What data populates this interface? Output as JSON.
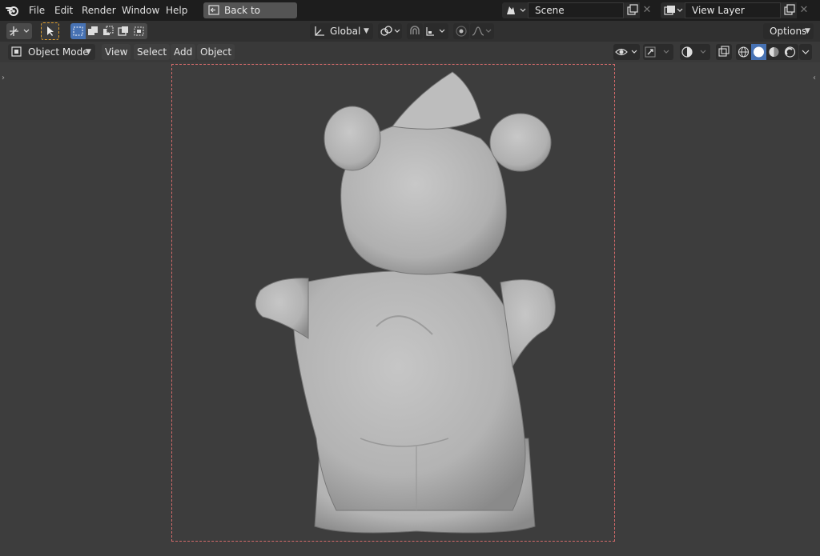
{
  "topbar": {
    "menus": [
      "File",
      "Edit",
      "Render",
      "Window",
      "Help"
    ],
    "back_button": "Back to Previous",
    "scene": {
      "value": "Scene"
    },
    "view_layer": {
      "value": "View Layer"
    }
  },
  "tool_settings": {
    "transform_orientation": "Global",
    "options_label": "Options"
  },
  "header": {
    "mode": "Object Mode",
    "menus": [
      "View",
      "Select",
      "Add",
      "Object"
    ]
  },
  "colors": {
    "active_accent": "#4772b3",
    "camera_frame": "#d36a6a",
    "model": "#b5b5b5"
  }
}
